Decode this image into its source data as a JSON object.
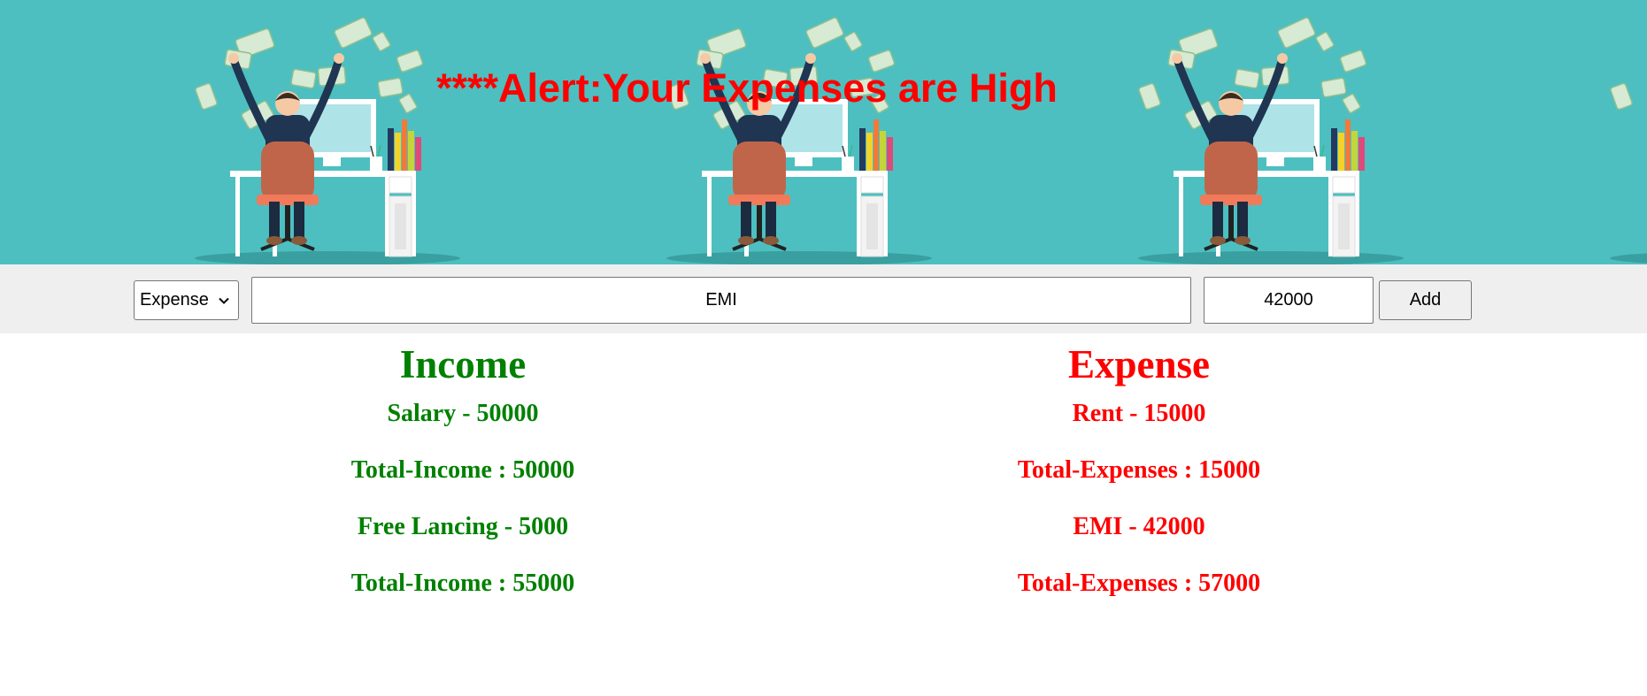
{
  "banner": {
    "alert_text": "****Alert:Your Expenses are High"
  },
  "form": {
    "type_select": {
      "selected": "Expense",
      "icon": "chevron-down-icon"
    },
    "description_value": "EMI",
    "amount_value": "42000",
    "add_label": "Add"
  },
  "income": {
    "heading": "Income",
    "entries": [
      "Salary - 50000",
      "Total-Income : 50000",
      "Free Lancing - 5000",
      "Total-Income : 55000"
    ]
  },
  "expense": {
    "heading": "Expense",
    "entries": [
      "Rent - 15000",
      "Total-Expenses : 15000",
      "EMI - 42000",
      "Total-Expenses : 57000"
    ]
  },
  "colors": {
    "banner_bg": "#4dbfc0",
    "income": "#008000",
    "expense": "#ff0000",
    "alert": "#ff0000"
  }
}
